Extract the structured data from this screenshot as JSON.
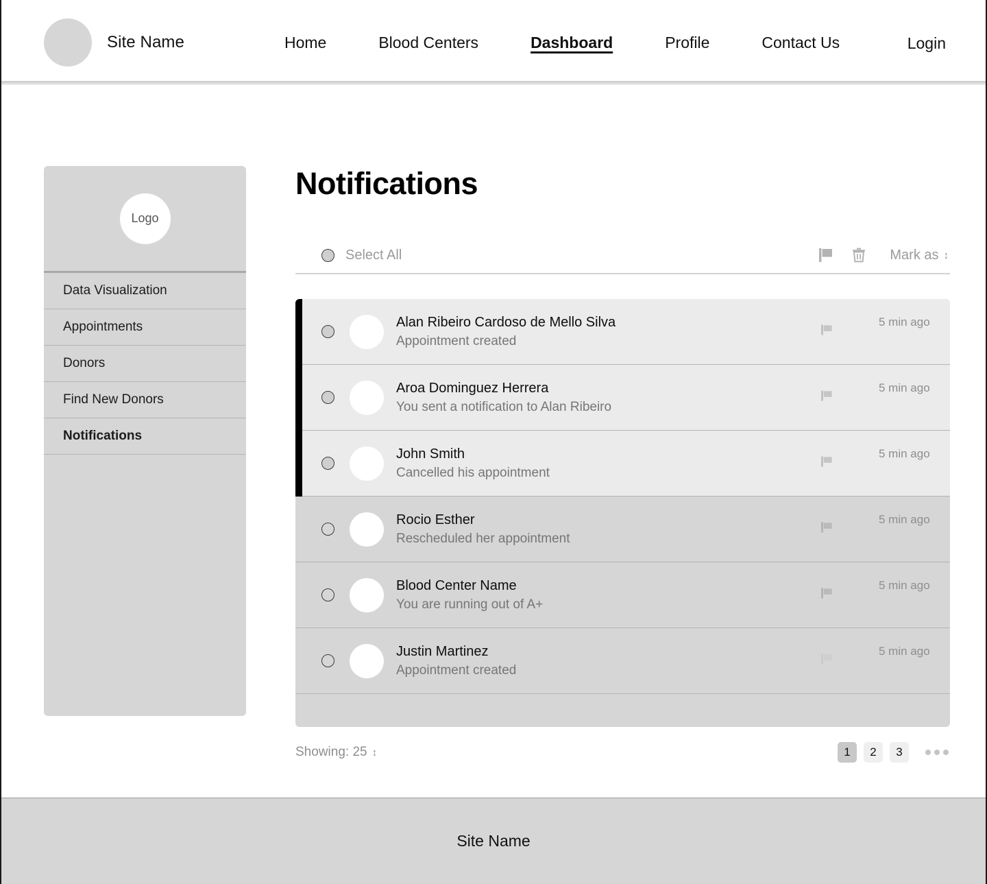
{
  "header": {
    "brand_name": "Site Name",
    "logo_icon": "circle-avatar-placeholder",
    "nav": [
      {
        "label": "Home",
        "active": false
      },
      {
        "label": "Blood Centers",
        "active": false
      },
      {
        "label": "Dashboard",
        "active": true
      },
      {
        "label": "Profile",
        "active": false
      },
      {
        "label": "Contact Us",
        "active": false
      }
    ],
    "login_label": "Login"
  },
  "sidebar": {
    "logo_label": "Logo",
    "items": [
      {
        "label": "Data Visualization",
        "active": false
      },
      {
        "label": "Appointments",
        "active": false
      },
      {
        "label": "Donors",
        "active": false
      },
      {
        "label": "Find New Donors",
        "active": false
      },
      {
        "label": "Notifications",
        "active": true
      }
    ]
  },
  "main": {
    "title": "Notifications",
    "toolbar": {
      "select_all_label": "Select All",
      "flag_icon": "flag-icon",
      "delete_icon": "trash-icon",
      "mark_as_label": "Mark as",
      "mark_as_caret": "↕"
    },
    "notifications": [
      {
        "name": "Alan Ribeiro Cardoso de Mello Silva",
        "message": "Appointment created",
        "time": "5 min ago",
        "unread": true,
        "flag_active": true
      },
      {
        "name": "Aroa Dominguez Herrera",
        "message": "You sent a notification to Alan Ribeiro",
        "time": "5 min ago",
        "unread": true,
        "flag_active": true
      },
      {
        "name": "John Smith",
        "message": "Cancelled his appointment",
        "time": "5 min ago",
        "unread": true,
        "flag_active": true
      },
      {
        "name": "Rocio Esther",
        "message": "Rescheduled her appointment",
        "time": "5 min ago",
        "unread": false,
        "flag_active": true
      },
      {
        "name": "Blood Center Name",
        "message": "You are running out of A+",
        "time": "5 min ago",
        "unread": false,
        "flag_active": true
      },
      {
        "name": "Justin Martinez",
        "message": "Appointment created",
        "time": "5 min ago",
        "unread": false,
        "flag_active": false
      }
    ],
    "footer_controls": {
      "showing_label": "Showing: 25",
      "showing_caret": "↕",
      "pages": [
        "1",
        "2",
        "3"
      ],
      "active_page": "1",
      "more_icon": "ellipsis-icon"
    }
  },
  "footer": {
    "site_name": "Site Name"
  },
  "colors": {
    "unread_row": "#ebebeb",
    "read_row": "#d6d6d6",
    "unread_bar": "#000000",
    "panel": "#d6d6d6",
    "muted_text": "#8e8e8e"
  }
}
